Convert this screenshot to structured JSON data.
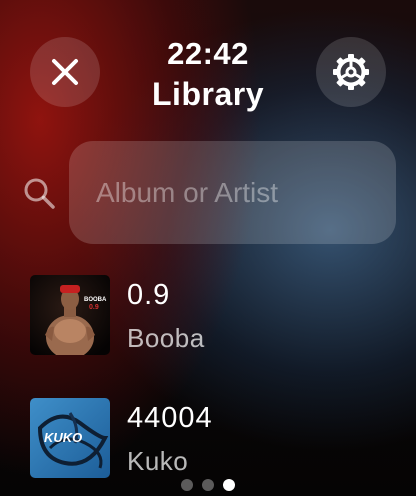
{
  "header": {
    "time": "22:42",
    "title": "Library",
    "close_icon": "close-icon",
    "settings_icon": "gear-icon"
  },
  "search": {
    "placeholder": "Album or Artist",
    "icon": "search-icon"
  },
  "albums": [
    {
      "title": "0.9",
      "artist": "Booba",
      "cover_text": "BOOBA",
      "cover_subtext": "0.9"
    },
    {
      "title": "44004",
      "artist": "Kuko",
      "cover_text": "KUKO"
    }
  ],
  "pagination": {
    "pages": 3,
    "current": 3
  }
}
